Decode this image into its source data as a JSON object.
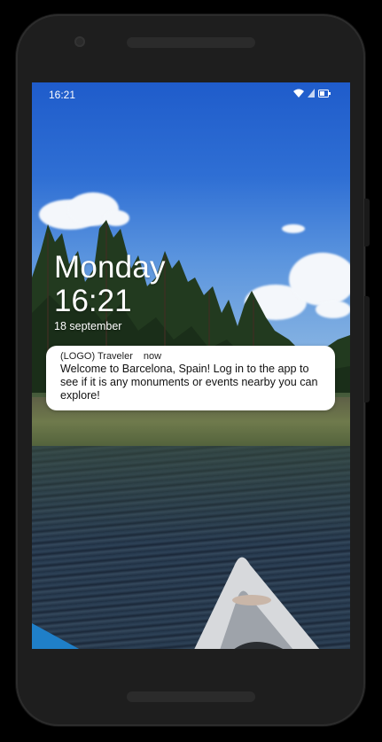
{
  "status_bar": {
    "time": "16:21",
    "icons": [
      "wifi-icon",
      "signal-icon",
      "battery-icon"
    ]
  },
  "lock_screen": {
    "day": "Monday",
    "time": "16:21",
    "date": "18 september"
  },
  "notification": {
    "app": "(LOGO) Traveler",
    "when": "now",
    "message": "Welcome to Barcelona, Spain! Log in to the app to see if it is any monuments or events nearby you can explore!"
  },
  "colors": {
    "device_body": "#1e1e1e",
    "notification_bg": "#ffffff",
    "text_light": "#ffffff"
  }
}
